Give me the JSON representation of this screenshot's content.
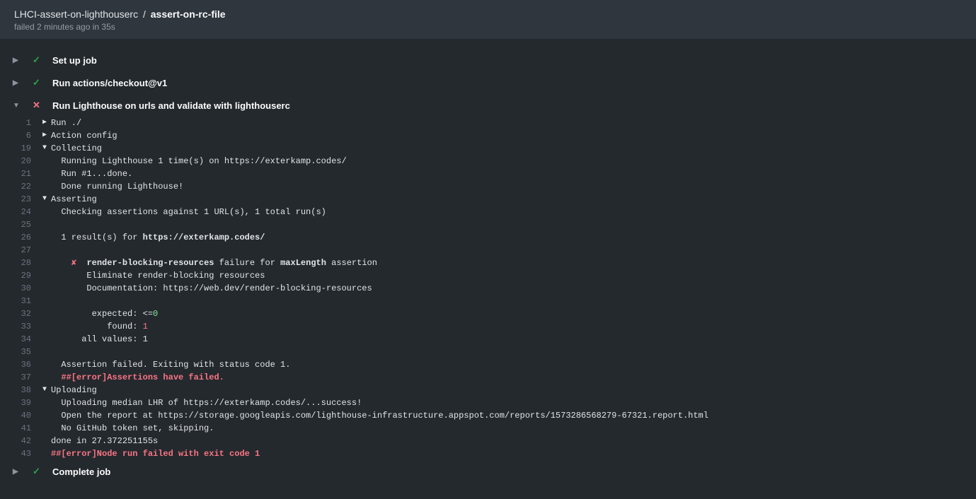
{
  "header": {
    "parent": "LHCI-assert-on-lighthouserc",
    "sep": "/",
    "current": "assert-on-rc-file",
    "subline": "failed 2 minutes ago in 35s"
  },
  "steps": {
    "setup": "Set up job",
    "checkout": "Run actions/checkout@v1",
    "lighthouse": "Run Lighthouse on urls and validate with lighthouserc",
    "complete": "Complete job"
  },
  "log": {
    "l1": "Run ./",
    "l6": "Action config",
    "l19": "Collecting",
    "l20": "  Running Lighthouse 1 time(s) on https://exterkamp.codes/",
    "l21": "  Run #1...done.",
    "l22": "  Done running Lighthouse!",
    "l23": "Asserting",
    "l24": "  Checking assertions against 1 URL(s), 1 total run(s)",
    "l26a": "  1 result(s) for ",
    "l26b": "https://exterkamp.codes/",
    "l28_x": "✘",
    "l28_b1": "render-blocking-resources",
    "l28_m1": " failure for ",
    "l28_b2": "maxLength",
    "l28_m2": " assertion",
    "l29": "       Eliminate render-blocking resources",
    "l30": "       Documentation: https://web.dev/render-blocking-resources",
    "l32a": "        expected: <=",
    "l32b": "0",
    "l33a": "           found: ",
    "l33b": "1",
    "l34": "      all values: 1",
    "l36": "  Assertion failed. Exiting with status code 1.",
    "l37": "  ##[error]Assertions have failed.",
    "l38": "Uploading",
    "l39": "  Uploading median LHR of https://exterkamp.codes/...success!",
    "l40": "  Open the report at https://storage.googleapis.com/lighthouse-infrastructure.appspot.com/reports/1573286568279-67321.report.html",
    "l41": "  No GitHub token set, skipping.",
    "l42": "done in 27.372251155s",
    "l43": "##[error]Node run failed with exit code 1"
  },
  "ln": {
    "n1": "1",
    "n6": "6",
    "n19": "19",
    "n20": "20",
    "n21": "21",
    "n22": "22",
    "n23": "23",
    "n24": "24",
    "n25": "25",
    "n26": "26",
    "n27": "27",
    "n28": "28",
    "n29": "29",
    "n30": "30",
    "n31": "31",
    "n32": "32",
    "n33": "33",
    "n34": "34",
    "n35": "35",
    "n36": "36",
    "n37": "37",
    "n38": "38",
    "n39": "39",
    "n40": "40",
    "n41": "41",
    "n42": "42",
    "n43": "43"
  }
}
